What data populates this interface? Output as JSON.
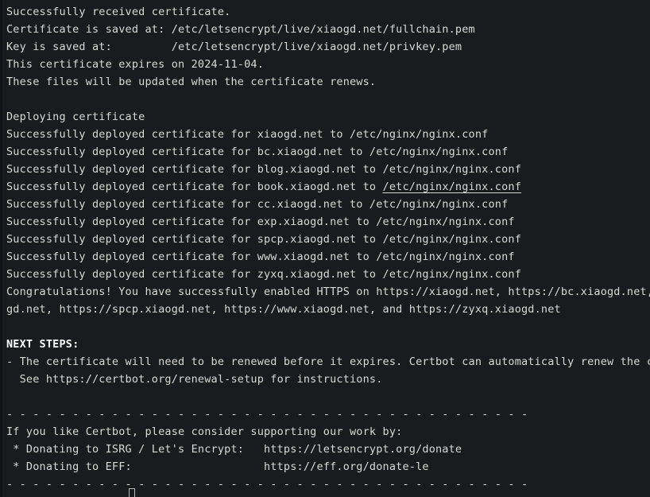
{
  "terminal": {
    "background_color": "#1a1b1e",
    "foreground_color": "#d9d9d4",
    "bold_color": "#ffffff",
    "cursor": {
      "style": "hollow-block",
      "column": 19,
      "row": 28
    }
  },
  "lines": [
    {
      "id": "l01",
      "text": "Successfully received certificate."
    },
    {
      "id": "l02",
      "text": "Certificate is saved at: /etc/letsencrypt/live/xiaogd.net/fullchain.pem"
    },
    {
      "id": "l03",
      "text": "Key is saved at:         /etc/letsencrypt/live/xiaogd.net/privkey.pem"
    },
    {
      "id": "l04",
      "text": "This certificate expires on 2024-11-04."
    },
    {
      "id": "l05",
      "text": "These files will be updated when the certificate renews."
    },
    {
      "id": "l06",
      "text": ""
    },
    {
      "id": "l07",
      "text": "Deploying certificate"
    },
    {
      "id": "l08",
      "text": "Successfully deployed certificate for xiaogd.net to /etc/nginx/nginx.conf"
    },
    {
      "id": "l09",
      "text": "Successfully deployed certificate for bc.xiaogd.net to /etc/nginx/nginx.conf"
    },
    {
      "id": "l10",
      "text": "Successfully deployed certificate for blog.xiaogd.net to /etc/nginx/nginx.conf"
    },
    {
      "id": "l11a",
      "text": "Successfully deployed certificate for book.xiaogd.net to "
    },
    {
      "id": "l11b",
      "text": "/etc/nginx/nginx.conf"
    },
    {
      "id": "l12",
      "text": "Successfully deployed certificate for cc.xiaogd.net to /etc/nginx/nginx.conf"
    },
    {
      "id": "l13",
      "text": "Successfully deployed certificate for exp.xiaogd.net to /etc/nginx/nginx.conf"
    },
    {
      "id": "l14",
      "text": "Successfully deployed certificate for spcp.xiaogd.net to /etc/nginx/nginx.conf"
    },
    {
      "id": "l15",
      "text": "Successfully deployed certificate for www.xiaogd.net to /etc/nginx/nginx.conf"
    },
    {
      "id": "l16",
      "text": "Successfully deployed certificate for zyxq.xiaogd.net to /etc/nginx/nginx.conf"
    },
    {
      "id": "l17",
      "text": "Congratulations! You have successfully enabled HTTPS on https://xiaogd.net, https://bc.xiaogd.net, https://blog.xiaogd.net, https://book.xiaogd.net, https://cc.xiaogd.net, https://exp.xiao"
    },
    {
      "id": "l18",
      "text": "gd.net, https://spcp.xiaogd.net, https://www.xiaogd.net, and https://zyxq.xiaogd.net"
    },
    {
      "id": "l19",
      "text": ""
    },
    {
      "id": "l20",
      "text": "NEXT STEPS:"
    },
    {
      "id": "l21",
      "text": "- The certificate will need to be renewed before it expires. Certbot can automatically renew the certificate in the background, but you may need to take steps to enable that functionality."
    },
    {
      "id": "l22",
      "text": "  See https://certbot.org/renewal-setup for instructions."
    },
    {
      "id": "l23",
      "text": ""
    },
    {
      "id": "l24",
      "text": "- - - - - - - - - - - - - - - - - - - - - - - - - - - - - - - - - - - - - - - -"
    },
    {
      "id": "l25",
      "text": "If you like Certbot, please consider supporting our work by:"
    },
    {
      "id": "l26",
      "text": " * Donating to ISRG / Let's Encrypt:   https://letsencrypt.org/donate"
    },
    {
      "id": "l27",
      "text": " * Donating to EFF:                    https://eff.org/donate-le"
    },
    {
      "id": "l28",
      "text": "- - - - - - - - - - - - - - - - - - - - - - - - - - - - - - - - - - - - - - - -"
    }
  ]
}
